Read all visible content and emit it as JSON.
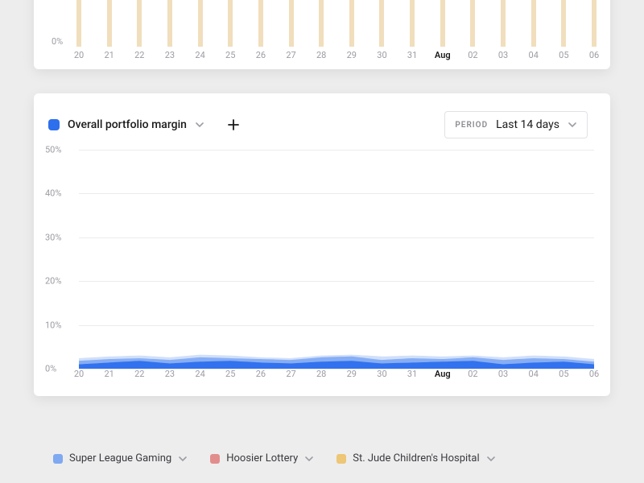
{
  "top_card": {
    "y_zero": "0%",
    "x_labels": [
      "20",
      "21",
      "22",
      "23",
      "24",
      "25",
      "26",
      "27",
      "28",
      "29",
      "30",
      "31",
      "Aug",
      "02",
      "03",
      "04",
      "05",
      "06"
    ],
    "bold_index": 12
  },
  "main_card": {
    "metric": {
      "name": "Overall portfolio margin",
      "color": "#2d6fed"
    },
    "period": {
      "label": "PERIOD",
      "value": "Last 14 days"
    },
    "y_ticks": [
      "50%",
      "40%",
      "30%",
      "20%",
      "10%",
      "0%"
    ],
    "x_labels": [
      "20",
      "21",
      "22",
      "23",
      "24",
      "25",
      "26",
      "27",
      "28",
      "29",
      "30",
      "31",
      "Aug",
      "02",
      "03",
      "04",
      "05",
      "06"
    ],
    "bold_index": 12
  },
  "bottom_legend": {
    "items": [
      {
        "color": "#7fa9f1",
        "name": "Super League Gaming"
      },
      {
        "color": "#e28d8d",
        "name": "Hoosier Lottery"
      },
      {
        "color": "#edc676",
        "name": "St. Jude Children's Hospital"
      }
    ]
  },
  "chart_data": [
    {
      "type": "bar",
      "note": "partial view, top chart",
      "categories": [
        "20",
        "21",
        "22",
        "23",
        "24",
        "25",
        "26",
        "27",
        "28",
        "29",
        "30",
        "31",
        "Aug",
        "02",
        "03",
        "04",
        "05",
        "06"
      ],
      "values": [
        null,
        null,
        null,
        null,
        null,
        null,
        null,
        null,
        null,
        null,
        null,
        null,
        null,
        null,
        null,
        null,
        null,
        null
      ],
      "ylabel": "%",
      "visible_ticks": [
        "0%"
      ]
    },
    {
      "type": "area",
      "title": "Overall portfolio margin",
      "ylabel": "%",
      "ylim": [
        0,
        50
      ],
      "x": [
        "20",
        "21",
        "22",
        "23",
        "24",
        "25",
        "26",
        "27",
        "28",
        "29",
        "30",
        "31",
        "Aug",
        "02",
        "03",
        "04",
        "05",
        "06"
      ],
      "series": [
        {
          "name": "front",
          "color": "#2d6fed",
          "values": [
            1.0,
            1.4,
            1.8,
            1.2,
            1.6,
            1.8,
            1.4,
            1.2,
            1.6,
            1.8,
            1.2,
            1.4,
            1.6,
            1.8,
            1.0,
            1.4,
            1.6,
            1.0
          ]
        },
        {
          "name": "mid",
          "color": "#6f9ef1",
          "values": [
            1.8,
            2.2,
            2.4,
            2.0,
            2.6,
            2.4,
            2.2,
            2.0,
            2.6,
            2.8,
            2.0,
            2.4,
            2.2,
            2.6,
            2.0,
            2.4,
            2.2,
            1.6
          ]
        },
        {
          "name": "back",
          "color": "#a9c5f6",
          "values": [
            2.4,
            2.8,
            3.0,
            2.6,
            3.2,
            3.0,
            2.6,
            2.4,
            3.0,
            3.2,
            2.8,
            3.0,
            2.8,
            3.0,
            2.6,
            3.0,
            2.8,
            2.2
          ]
        }
      ]
    }
  ]
}
